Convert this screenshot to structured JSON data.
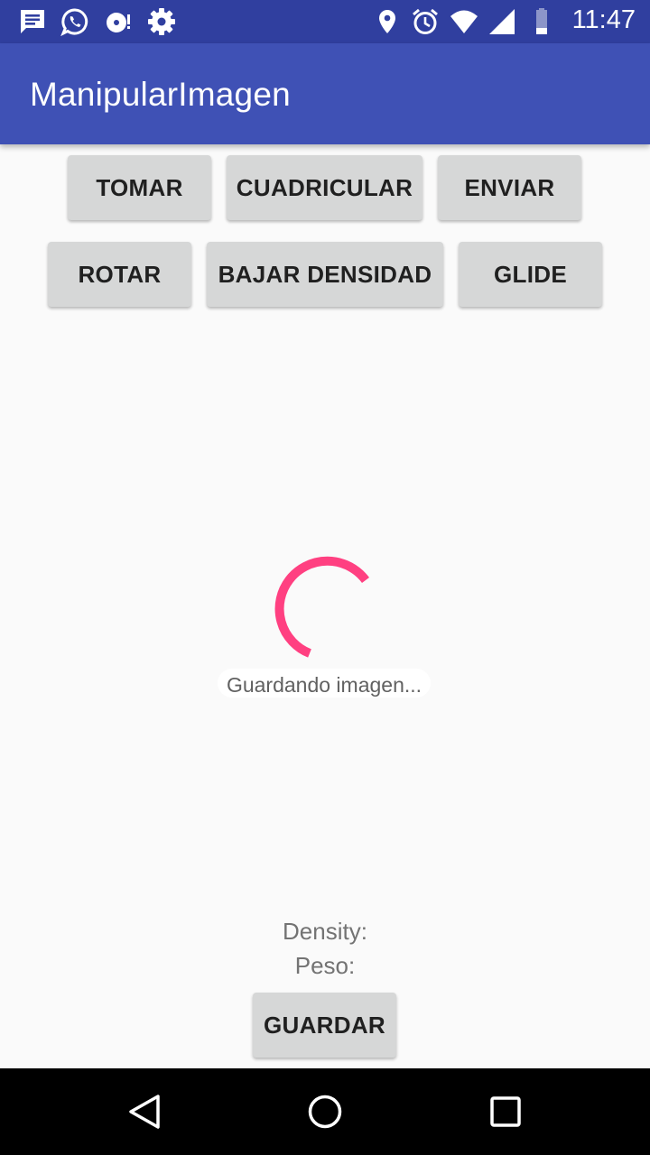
{
  "status_bar": {
    "time": "11:47",
    "left_icons": [
      "message-icon",
      "whatsapp-icon",
      "sync-disc-icon",
      "settings-gear-icon"
    ],
    "right_icons": [
      "location-pin-icon",
      "alarm-clock-icon",
      "wifi-icon",
      "cell-signal-icon",
      "battery-icon"
    ]
  },
  "app_bar": {
    "title": "ManipularImagen",
    "color": "#3f51b5"
  },
  "buttons_row1": {
    "tomar": "TOMAR",
    "cuadricular": "CUADRICULAR",
    "enviar": "ENVIAR"
  },
  "buttons_row2": {
    "rotar": "ROTAR",
    "bajar_densidad": "BAJAR DENSIDAD",
    "glide": "GLIDE"
  },
  "progress": {
    "message": "Guardando imagen...",
    "accent_color": "#ff4081"
  },
  "info": {
    "density_label": "Density:",
    "peso_label": "Peso:"
  },
  "footer": {
    "guardar": "GUARDAR"
  },
  "nav_bar": {
    "icons": [
      "back-icon",
      "home-icon",
      "recents-icon"
    ]
  }
}
